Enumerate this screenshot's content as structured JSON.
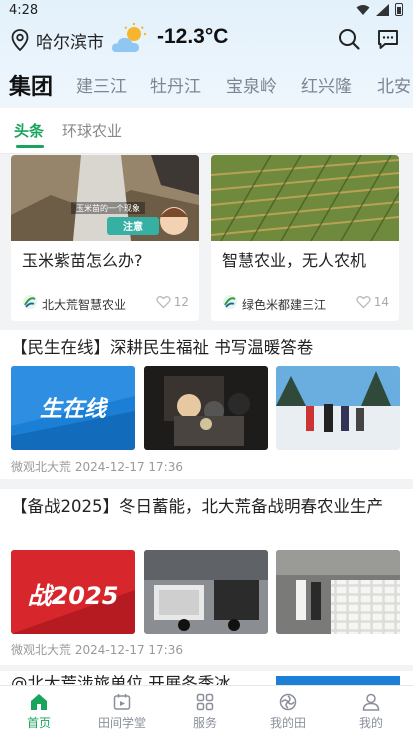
{
  "status_bar": {
    "time": "4:28"
  },
  "location": {
    "city": "哈尔滨市",
    "temperature": "-12.3°C",
    "weather_icon": "partly-sunny-icon"
  },
  "channels": [
    {
      "label": "集团",
      "active": true
    },
    {
      "label": "建三江"
    },
    {
      "label": "牡丹江"
    },
    {
      "label": "宝泉岭"
    },
    {
      "label": "红兴隆"
    },
    {
      "label": "北安"
    }
  ],
  "subtabs": [
    {
      "label": "头条",
      "active": true
    },
    {
      "label": "环球农业"
    }
  ],
  "cards": [
    {
      "title": "玉米紫苗怎么办?",
      "source": "北大荒智慧农业",
      "likes": "12",
      "image_caption": "玉米苗的一个现象",
      "image_badge": "注意"
    },
    {
      "title": "智慧农业，无人农机",
      "source": "绿色米都建三江",
      "likes": "14"
    }
  ],
  "articles": [
    {
      "title": "【民生在线】深耕民生福祉 书写温暖答卷",
      "banner_text": "生在线",
      "source": "微观北大荒",
      "date": "2024-12-17 17:36"
    },
    {
      "title": "【备战2025】冬日蓄能，北大荒备战明春农业生产",
      "banner_text": "战2025",
      "source": "微观北大荒",
      "date": "2024-12-17 17:36"
    },
    {
      "title": "@北大荒涉旅单位 开展冬季冰"
    }
  ],
  "tabbar": [
    {
      "label": "首页",
      "icon": "home-icon",
      "active": true
    },
    {
      "label": "田间学堂",
      "icon": "classroom-icon"
    },
    {
      "label": "服务",
      "icon": "grid-icon"
    },
    {
      "label": "我的田",
      "icon": "field-icon"
    },
    {
      "label": "我的",
      "icon": "profile-icon"
    }
  ],
  "colors": {
    "accent": "#19a45e",
    "header_bg": "#e3f1fb",
    "red_banner": "#d8262d",
    "blue_banner": "#1b7fd6"
  }
}
